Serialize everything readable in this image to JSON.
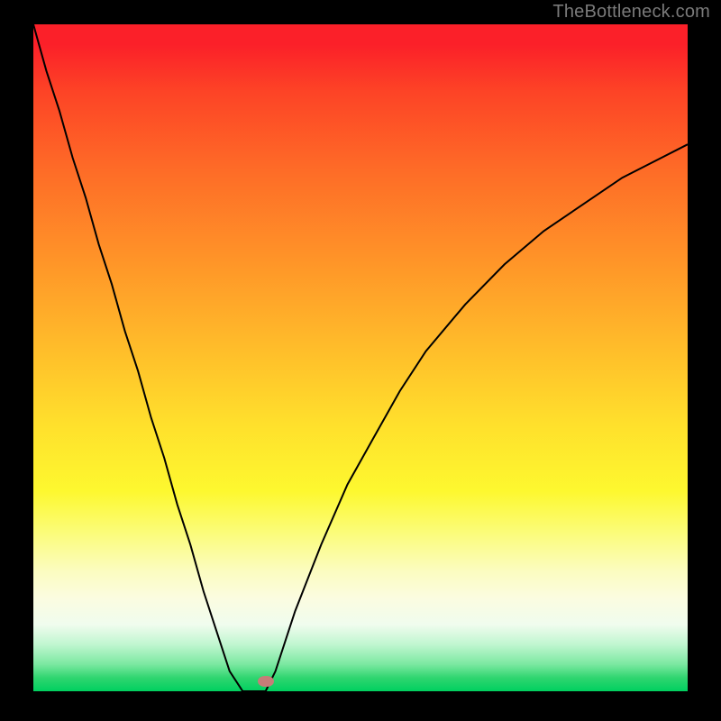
{
  "watermark": "TheBottleneck.com",
  "chart_data": {
    "type": "line",
    "title": "",
    "xlabel": "",
    "ylabel": "",
    "x": [
      0.0,
      0.02,
      0.04,
      0.06,
      0.08,
      0.1,
      0.12,
      0.14,
      0.16,
      0.18,
      0.2,
      0.22,
      0.24,
      0.26,
      0.28,
      0.3,
      0.32,
      0.34,
      0.355,
      0.37,
      0.4,
      0.44,
      0.48,
      0.52,
      0.56,
      0.6,
      0.66,
      0.72,
      0.78,
      0.84,
      0.9,
      0.96,
      1.0
    ],
    "y": [
      1.0,
      0.93,
      0.87,
      0.8,
      0.74,
      0.67,
      0.61,
      0.54,
      0.48,
      0.41,
      0.35,
      0.28,
      0.22,
      0.15,
      0.09,
      0.03,
      0.0,
      0.0,
      0.0,
      0.03,
      0.12,
      0.22,
      0.31,
      0.38,
      0.45,
      0.51,
      0.58,
      0.64,
      0.69,
      0.73,
      0.77,
      0.8,
      0.82
    ],
    "xlim": [
      0,
      1
    ],
    "ylim": [
      0,
      1
    ],
    "minimum_marker": {
      "x": 0.355,
      "y": 0.007
    },
    "background_gradient_top_to_bottom": [
      "#fb2029",
      "#ffbb2a",
      "#fdf82f",
      "#00d060"
    ],
    "annotations": []
  }
}
